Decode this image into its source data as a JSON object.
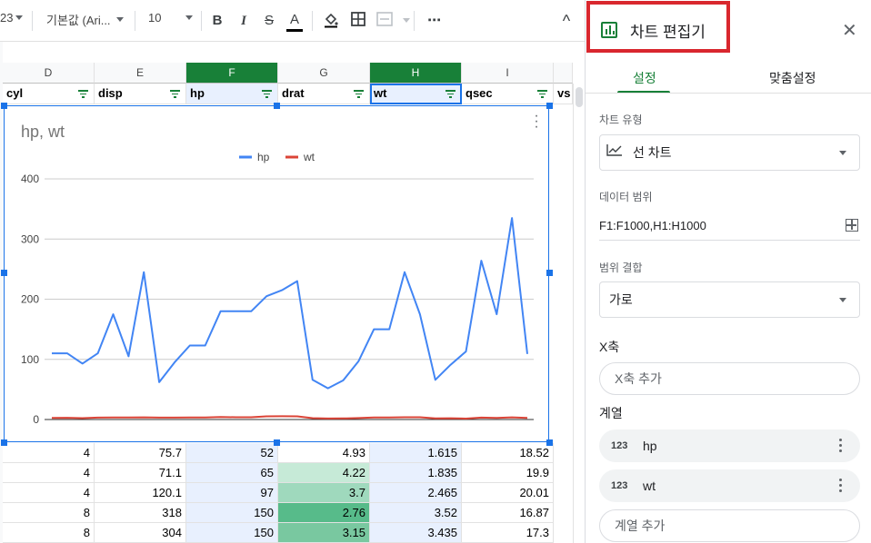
{
  "toolbar": {
    "format_label": "23",
    "font_family": "기본값 (Ari...",
    "font_size": "10",
    "bold": "B",
    "italic": "I",
    "strike": "S",
    "text_color": "A",
    "more": "⋯",
    "collapse": "^"
  },
  "columns": [
    "D",
    "E",
    "F",
    "G",
    "H",
    "I"
  ],
  "fields": [
    "cyl",
    "disp",
    "hp",
    "drat",
    "wt",
    "qsec",
    "vs"
  ],
  "rows": [
    [
      "4",
      "75.7",
      "52",
      "4.93",
      "1.615",
      "18.52"
    ],
    [
      "4",
      "71.1",
      "65",
      "4.22",
      "1.835",
      "19.9"
    ],
    [
      "4",
      "120.1",
      "97",
      "3.7",
      "2.465",
      "20.01"
    ],
    [
      "8",
      "318",
      "150",
      "2.76",
      "3.52",
      "16.87"
    ],
    [
      "8",
      "304",
      "150",
      "3.15",
      "3.435",
      "17.3"
    ]
  ],
  "drat_colors": [
    "#ffffff",
    "#c6ead7",
    "#9fd9bd",
    "#57bb8a",
    "#79c8a0"
  ],
  "chart_data": {
    "type": "line",
    "title": "hp, wt",
    "legend": "top-center",
    "ylim": [
      0,
      400
    ],
    "yticks": [
      "0",
      "100",
      "200",
      "300",
      "400"
    ],
    "grid": true,
    "series": [
      {
        "name": "hp",
        "color": "#4285f4",
        "values": [
          110,
          110,
          93,
          110,
          175,
          105,
          245,
          62,
          95,
          123,
          123,
          180,
          180,
          180,
          205,
          215,
          230,
          66,
          52,
          65,
          97,
          150,
          150,
          245,
          175,
          66,
          91,
          113,
          264,
          175,
          335,
          109
        ]
      },
      {
        "name": "wt",
        "color": "#db4437",
        "values": [
          2.62,
          2.875,
          2.32,
          3.215,
          3.44,
          3.46,
          3.57,
          3.19,
          3.15,
          3.44,
          3.44,
          4.07,
          3.73,
          3.78,
          5.25,
          5.424,
          5.345,
          2.2,
          1.615,
          1.835,
          2.465,
          3.52,
          3.435,
          3.84,
          3.845,
          1.935,
          2.14,
          1.513,
          3.17,
          2.77,
          3.57,
          2.78
        ]
      }
    ]
  },
  "panel": {
    "title": "차트 편집기",
    "tab_setup": "설정",
    "tab_customize": "맞춤설정",
    "chart_type_label": "차트 유형",
    "chart_type_value": "선 차트",
    "data_range_label": "데이터 범위",
    "data_range_value": "F1:F1000,H1:H1000",
    "combine_label": "범위 결합",
    "combine_value": "가로",
    "x_axis_label": "X축",
    "add_x_axis": "X축 추가",
    "series_label": "계열",
    "series": [
      {
        "icon": "123",
        "name": "hp"
      },
      {
        "icon": "123",
        "name": "wt"
      }
    ],
    "add_series": "계열 추가"
  },
  "colors": {
    "accent": "#188038",
    "highlight_box": "#d9272e",
    "selection": "#1a73e8"
  }
}
